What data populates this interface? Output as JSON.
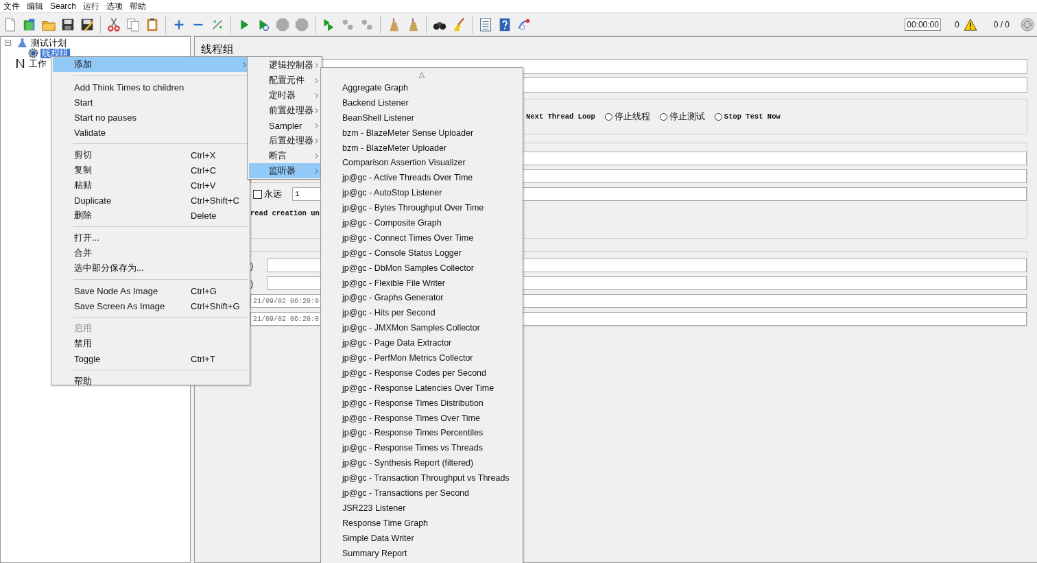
{
  "menubar": [
    "文件",
    "编辑",
    "Search",
    "运行",
    "选项",
    "帮助"
  ],
  "toolbar": {
    "timer": "00:00:00",
    "warning_count": "0",
    "thread_count": "0 / 0"
  },
  "tree": [
    {
      "label": "测试计划",
      "expanded": true,
      "selected": false,
      "children": [
        {
          "label": "线程组",
          "selected": true
        }
      ]
    },
    {
      "label": "工作",
      "selected": false
    }
  ],
  "editor": {
    "title": "线程组",
    "error_option_text": "Next Thread Loop",
    "error_options": [
      {
        "label": "停止线程",
        "selected": false
      },
      {
        "label": "停止测试",
        "selected": false
      },
      {
        "label": "Stop Test Now",
        "selected": false
      }
    ],
    "loop_forever_checked": false,
    "loop_forever_label": "永远",
    "loop_count": "1",
    "delay_note": "read creation un",
    "duration_suffix": ")",
    "delay_suffix": ")",
    "start_time": "21/09/02 06:20:0",
    "end_time": "21/09/02 06:20:0"
  },
  "context_menu": [
    {
      "kind": "submenu",
      "label": "添加",
      "selected": true
    },
    {
      "kind": "separator"
    },
    {
      "kind": "item",
      "label": "Add Think Times to children",
      "disabled": false
    },
    {
      "kind": "item",
      "label": "Start",
      "disabled": false
    },
    {
      "kind": "item",
      "label": "Start no pauses",
      "disabled": false
    },
    {
      "kind": "item",
      "label": "Validate",
      "disabled": false
    },
    {
      "kind": "separator"
    },
    {
      "kind": "item",
      "label": "剪切",
      "shortcut": "Ctrl+X",
      "disabled": false
    },
    {
      "kind": "item",
      "label": "复制",
      "shortcut": "Ctrl+C",
      "disabled": false
    },
    {
      "kind": "item",
      "label": "粘贴",
      "shortcut": "Ctrl+V",
      "disabled": false
    },
    {
      "kind": "item",
      "label": "Duplicate",
      "shortcut": "Ctrl+Shift+C",
      "disabled": false
    },
    {
      "kind": "item",
      "label": "删除",
      "shortcut": "Delete",
      "disabled": false
    },
    {
      "kind": "separator"
    },
    {
      "kind": "item",
      "label": "打开...",
      "disabled": false
    },
    {
      "kind": "item",
      "label": "合并",
      "disabled": false
    },
    {
      "kind": "item",
      "label": "选中部分保存为...",
      "disabled": false
    },
    {
      "kind": "separator"
    },
    {
      "kind": "item",
      "label": "Save Node As Image",
      "shortcut": "Ctrl+G",
      "disabled": false
    },
    {
      "kind": "item",
      "label": "Save Screen As Image",
      "shortcut": "Ctrl+Shift+G",
      "disabled": false
    },
    {
      "kind": "separator"
    },
    {
      "kind": "item",
      "label": "启用",
      "disabled": true
    },
    {
      "kind": "item",
      "label": "禁用",
      "disabled": false
    },
    {
      "kind": "item",
      "label": "Toggle",
      "shortcut": "Ctrl+T",
      "disabled": false
    },
    {
      "kind": "separator"
    },
    {
      "kind": "item",
      "label": "帮助",
      "disabled": false
    }
  ],
  "add_submenu": [
    {
      "label": "逻辑控制器",
      "selected": false
    },
    {
      "label": "配置元件",
      "selected": false
    },
    {
      "label": "定时器",
      "selected": false
    },
    {
      "label": "前置处理器",
      "selected": false
    },
    {
      "label": "Sampler",
      "selected": false
    },
    {
      "label": "后置处理器",
      "selected": false
    },
    {
      "label": "断言",
      "selected": false
    },
    {
      "label": "监听器",
      "selected": true
    }
  ],
  "listener_submenu": {
    "scroll_up": "△",
    "items": [
      "Aggregate Graph",
      "Backend Listener",
      "BeanShell Listener",
      "bzm - BlazeMeter Sense Uploader",
      "bzm - BlazeMeter Uploader",
      "Comparison Assertion Visualizer",
      "jp@gc - Active Threads Over Time",
      "jp@gc - AutoStop Listener",
      "jp@gc - Bytes Throughput Over Time",
      "jp@gc - Composite Graph",
      "jp@gc - Connect Times Over Time",
      "jp@gc - Console Status Logger",
      "jp@gc - DbMon Samples Collector",
      "jp@gc - Flexible File Writer",
      "jp@gc - Graphs Generator",
      "jp@gc - Hits per Second",
      "jp@gc - JMXMon Samples Collector",
      "jp@gc - Page Data Extractor",
      "jp@gc - PerfMon Metrics Collector",
      "jp@gc - Response Codes per Second",
      "jp@gc - Response Latencies Over Time",
      "jp@gc - Response Times Distribution",
      "jp@gc - Response Times Over Time",
      "jp@gc - Response Times Percentiles",
      "jp@gc - Response Times vs Threads",
      "jp@gc - Synthesis Report (filtered)",
      "jp@gc - Transaction Throughput vs Threads",
      "jp@gc - Transactions per Second",
      "JSR223 Listener",
      "Response Time Graph",
      "Simple Data Writer",
      "Summary Report"
    ]
  }
}
